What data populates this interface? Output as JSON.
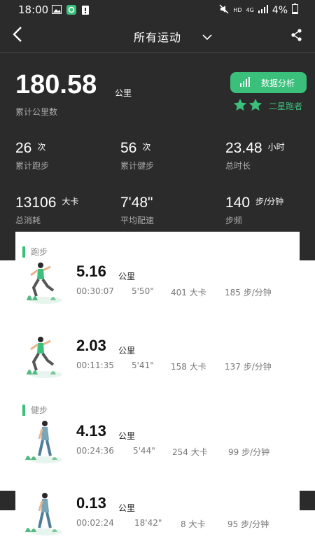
{
  "status_bar": {
    "time": "18:00",
    "network": "HD",
    "signal": "4G",
    "battery": "4%"
  },
  "nav": {
    "title": "所有运动"
  },
  "summary": {
    "total_value": "180.58",
    "total_unit": "公里",
    "total_label": "累计公里数",
    "analysis_button": "数据分析",
    "runner_level": "二星跑者",
    "stars": 2
  },
  "stats": [
    {
      "value": "26",
      "unit": "次",
      "label": "累计跑步"
    },
    {
      "value": "56",
      "unit": "次",
      "label": "累计健步"
    },
    {
      "value": "23.48",
      "unit": "小时",
      "label": "总时长"
    },
    {
      "value": "13106",
      "unit": "大卡",
      "label": "总消耗"
    },
    {
      "value": "7'48\"",
      "unit": "",
      "label": "平均配速"
    },
    {
      "value": "140",
      "unit": "步/分钟",
      "label": "步频"
    }
  ],
  "sections": [
    {
      "title": "跑步",
      "records": [
        {
          "distance": "5.16",
          "unit": "公里",
          "duration": "00:30:07",
          "pace": "5'50\"",
          "calories": "401 大卡",
          "cadence": "185 步/分钟"
        },
        {
          "distance": "2.03",
          "unit": "公里",
          "duration": "00:11:35",
          "pace": "5'41\"",
          "calories": "158 大卡",
          "cadence": "137 步/分钟"
        }
      ]
    },
    {
      "title": "健步",
      "records": [
        {
          "distance": "4.13",
          "unit": "公里",
          "duration": "00:24:36",
          "pace": "5'44\"",
          "calories": "254 大卡",
          "cadence": "99 步/分钟"
        },
        {
          "distance": "0.13",
          "unit": "公里",
          "duration": "00:02:24",
          "pace": "18'42\"",
          "calories": "8 大卡",
          "cadence": "95 步/分钟"
        }
      ]
    }
  ],
  "colors": {
    "accent": "#3bc07c",
    "dark_bg": "#2b2b2b"
  }
}
